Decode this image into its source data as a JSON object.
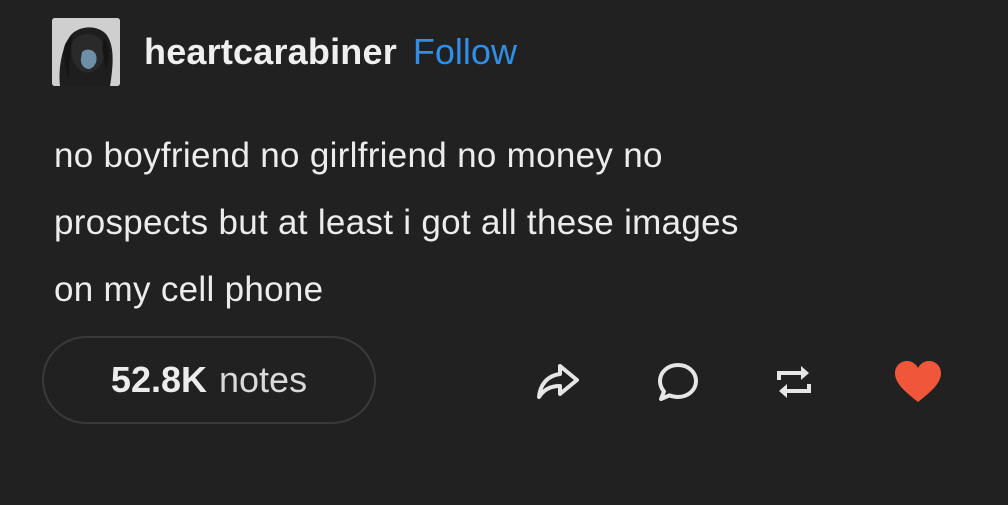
{
  "post": {
    "username": "heartcarabiner",
    "follow_label": "Follow",
    "body_lines": [
      "no boyfriend no girlfriend no money no",
      "prospects but at least i got all these images",
      "on my cell phone"
    ],
    "notes_count": "52.8K",
    "notes_label": "notes"
  },
  "colors": {
    "background": "#212121",
    "follow": "#2f8fe8",
    "like": "#f0563a"
  },
  "icons": [
    "share-icon",
    "reply-icon",
    "reblog-icon",
    "like-heart-icon"
  ],
  "state": {
    "liked": true
  }
}
